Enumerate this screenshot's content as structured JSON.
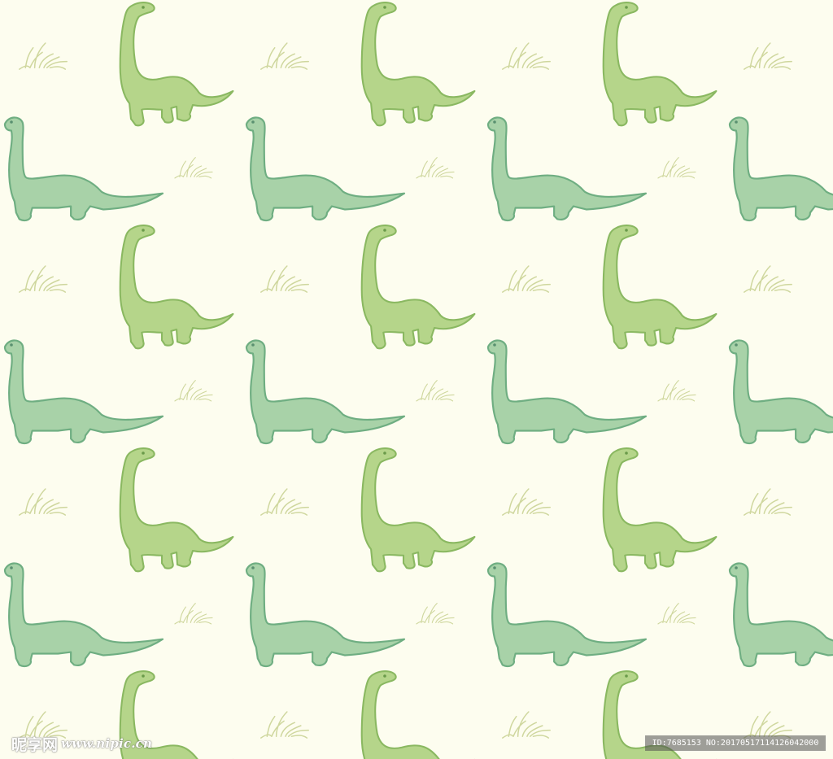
{
  "background_color": "#fdfdef",
  "motifs": {
    "upright_dinosaur": {
      "fill": "#b5d58a",
      "stroke": "#8ab861",
      "eye": "#6a9a4a"
    },
    "long_dinosaur": {
      "fill": "#a8d2a8",
      "stroke": "#6fae82",
      "eye": "#5a9070"
    },
    "grass_tuft": {
      "stroke": "#cfd79e"
    }
  },
  "watermark": {
    "site_name": "昵享网",
    "site_url": "www.nipic.cn",
    "id_label": "ID:7685153 NO:20170517114126042000"
  }
}
